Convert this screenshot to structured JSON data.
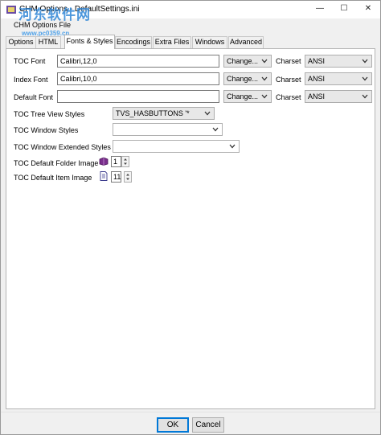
{
  "window": {
    "title": "CHM Options - DefaultSettings.ini",
    "minimize_glyph": "—",
    "maximize_glyph": "☐",
    "close_glyph": "✕"
  },
  "watermark": {
    "text": "河东软件网",
    "url": "www.pc0359.cn"
  },
  "menu": {
    "label": "CHM Options File"
  },
  "tabs": [
    {
      "label": "Options"
    },
    {
      "label": "HTML"
    },
    {
      "label": "Fonts & Styles",
      "active": true
    },
    {
      "label": "Encodings"
    },
    {
      "label": "Extra Files"
    },
    {
      "label": "Windows"
    },
    {
      "label": "Advanced"
    }
  ],
  "fonts": {
    "toc": {
      "label": "TOC Font",
      "value": "Calibri,12,0",
      "button": "Change...",
      "charset_label": "Charset",
      "charset": "ANSI"
    },
    "index": {
      "label": "Index Font",
      "value": "Calibri,10,0",
      "button": "Change...",
      "charset_label": "Charset",
      "charset": "ANSI"
    },
    "default": {
      "label": "Default Font",
      "value": "",
      "button": "Change...",
      "charset_label": "Charset",
      "charset": "ANSI"
    }
  },
  "styles": {
    "tree_view": {
      "label": "TOC Tree View Styles",
      "value": "TVS_HASBUTTONS '*"
    },
    "window": {
      "label": "TOC Window Styles",
      "value": ""
    },
    "window_ext": {
      "label": "TOC Window Extended Styles",
      "value": ""
    },
    "folder_image": {
      "label": "TOC Default Folder Image",
      "value": "1",
      "icon": "book-icon"
    },
    "item_image": {
      "label": "TOC Default Item Image",
      "value": "11",
      "icon": "page-icon"
    }
  },
  "footer": {
    "ok": "OK",
    "cancel": "Cancel"
  },
  "colors": {
    "accent": "#0078d7",
    "watermark": "#2f86d6",
    "book": "#7a2e8c"
  }
}
